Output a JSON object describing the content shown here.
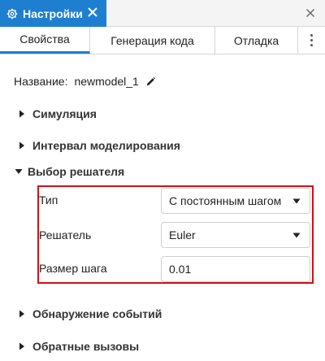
{
  "window": {
    "title": "Настройки"
  },
  "tabs": [
    {
      "label": "Свойства",
      "active": true
    },
    {
      "label": "Генерация кода",
      "active": false
    },
    {
      "label": "Отладка",
      "active": false
    }
  ],
  "name": {
    "label": "Название:",
    "value": "newmodel_1"
  },
  "sections": {
    "simulation": "Симуляция",
    "interval": "Интервал моделирования",
    "solver": "Выбор решателя",
    "events": "Обнаружение событий",
    "callbacks": "Обратные вызовы"
  },
  "solver": {
    "type_label": "Тип",
    "type_value": "С постоянным шагом",
    "solver_label": "Решатель",
    "solver_value": "Euler",
    "step_label": "Размер шага",
    "step_value": "0.01"
  },
  "colors": {
    "accent": "#1e7fd1",
    "highlight": "#d0101a"
  }
}
